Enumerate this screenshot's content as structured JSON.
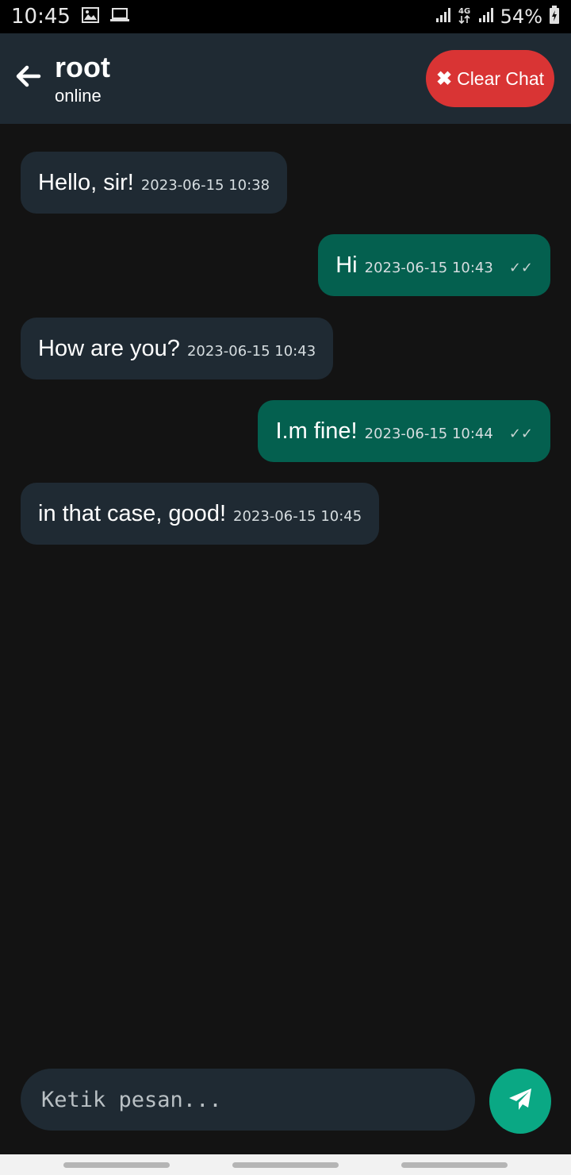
{
  "status_bar": {
    "time": "10:45",
    "battery": "54%",
    "network": "4G",
    "icons": [
      "image-icon",
      "laptop-icon",
      "signal-icon",
      "network-4g-icon",
      "signal-icon",
      "battery-charging-icon"
    ]
  },
  "header": {
    "name": "root",
    "status": "online",
    "clear_label": "Clear Chat",
    "clear_color": "#d93434"
  },
  "messages": [
    {
      "direction": "in",
      "text": "Hello, sir!",
      "time": "2023-06-15 10:38",
      "ticks": ""
    },
    {
      "direction": "out",
      "text": "Hi",
      "time": "2023-06-15 10:43",
      "ticks": "✓✓"
    },
    {
      "direction": "in",
      "text": "How are you?",
      "time": "2023-06-15 10:43",
      "ticks": ""
    },
    {
      "direction": "out",
      "text": "I.m fine!",
      "time": "2023-06-15 10:44",
      "ticks": "✓✓"
    },
    {
      "direction": "in",
      "text": "in that case, good!",
      "time": "2023-06-15 10:45",
      "ticks": ""
    }
  ],
  "composer": {
    "placeholder": "Ketik pesan...",
    "value": ""
  },
  "colors": {
    "background": "#131313",
    "incoming_bubble": "#1f2a33",
    "outgoing_bubble": "#04604f",
    "send_button": "#0aa884"
  }
}
